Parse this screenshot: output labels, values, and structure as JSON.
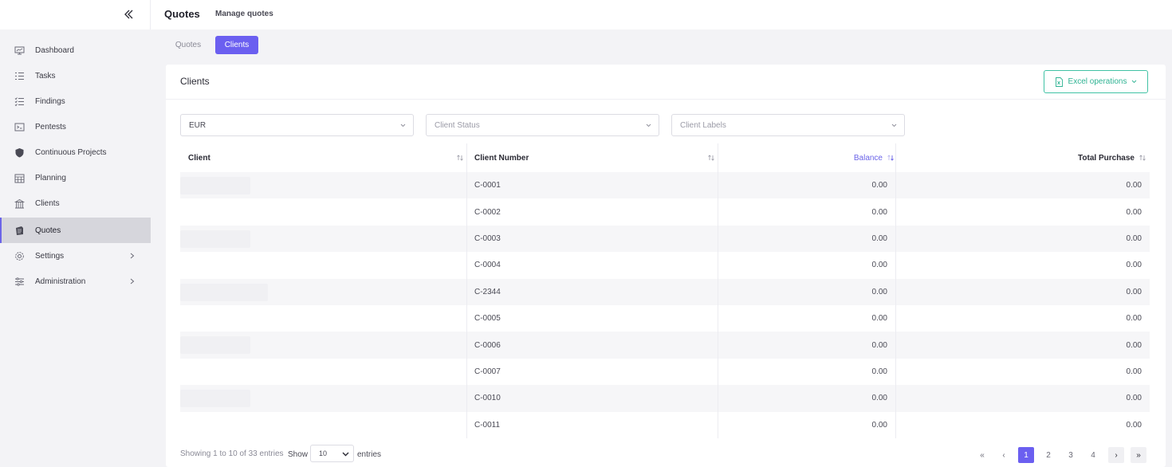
{
  "header": {
    "title": "Quotes",
    "subtitle": "Manage quotes"
  },
  "sidebar": {
    "items": [
      {
        "label": "Dashboard",
        "icon": "dashboard-icon"
      },
      {
        "label": "Tasks",
        "icon": "tasks-icon"
      },
      {
        "label": "Findings",
        "icon": "findings-icon"
      },
      {
        "label": "Pentests",
        "icon": "pentests-icon"
      },
      {
        "label": "Continuous Projects",
        "icon": "shield-icon"
      },
      {
        "label": "Planning",
        "icon": "calendar-icon"
      },
      {
        "label": "Clients",
        "icon": "clients-icon"
      },
      {
        "label": "Quotes",
        "icon": "quotes-icon",
        "active": true
      },
      {
        "label": "Settings",
        "icon": "gear-icon",
        "has_children": true
      },
      {
        "label": "Administration",
        "icon": "sliders-icon",
        "has_children": true
      }
    ]
  },
  "tabs": [
    {
      "label": "Quotes",
      "active": false
    },
    {
      "label": "Clients",
      "active": true
    }
  ],
  "card": {
    "title": "Clients",
    "excel_label": "Excel operations"
  },
  "filters": {
    "currency": "EUR",
    "status_placeholder": "Client Status",
    "labels_placeholder": "Client Labels"
  },
  "table": {
    "columns": [
      "Client",
      "Client Number",
      "Balance",
      "Total Purchase"
    ],
    "sorted_column": "Balance",
    "rows": [
      {
        "number": "C-0001",
        "balance": "0.00",
        "total": "0.00"
      },
      {
        "number": "C-0002",
        "balance": "0.00",
        "total": "0.00"
      },
      {
        "number": "C-0003",
        "balance": "0.00",
        "total": "0.00"
      },
      {
        "number": "C-0004",
        "balance": "0.00",
        "total": "0.00"
      },
      {
        "number": "C-2344",
        "balance": "0.00",
        "total": "0.00"
      },
      {
        "number": "C-0005",
        "balance": "0.00",
        "total": "0.00"
      },
      {
        "number": "C-0006",
        "balance": "0.00",
        "total": "0.00"
      },
      {
        "number": "C-0007",
        "balance": "0.00",
        "total": "0.00"
      },
      {
        "number": "C-0010",
        "balance": "0.00",
        "total": "0.00"
      },
      {
        "number": "C-0011",
        "balance": "0.00",
        "total": "0.00"
      }
    ]
  },
  "footer": {
    "info": "Showing 1 to 10 of 33 entries",
    "show_label": "Show",
    "page_size": "10",
    "entries_label": "entries",
    "pages": [
      "1",
      "2",
      "3",
      "4"
    ],
    "current_page": "1",
    "first_symbol": "«",
    "prev_symbol": "‹",
    "next_symbol": "›",
    "last_symbol": "»"
  },
  "colors": {
    "accent": "#6b5ff0",
    "excel": "#2fb393",
    "sorted_header": "#6b64e8"
  }
}
